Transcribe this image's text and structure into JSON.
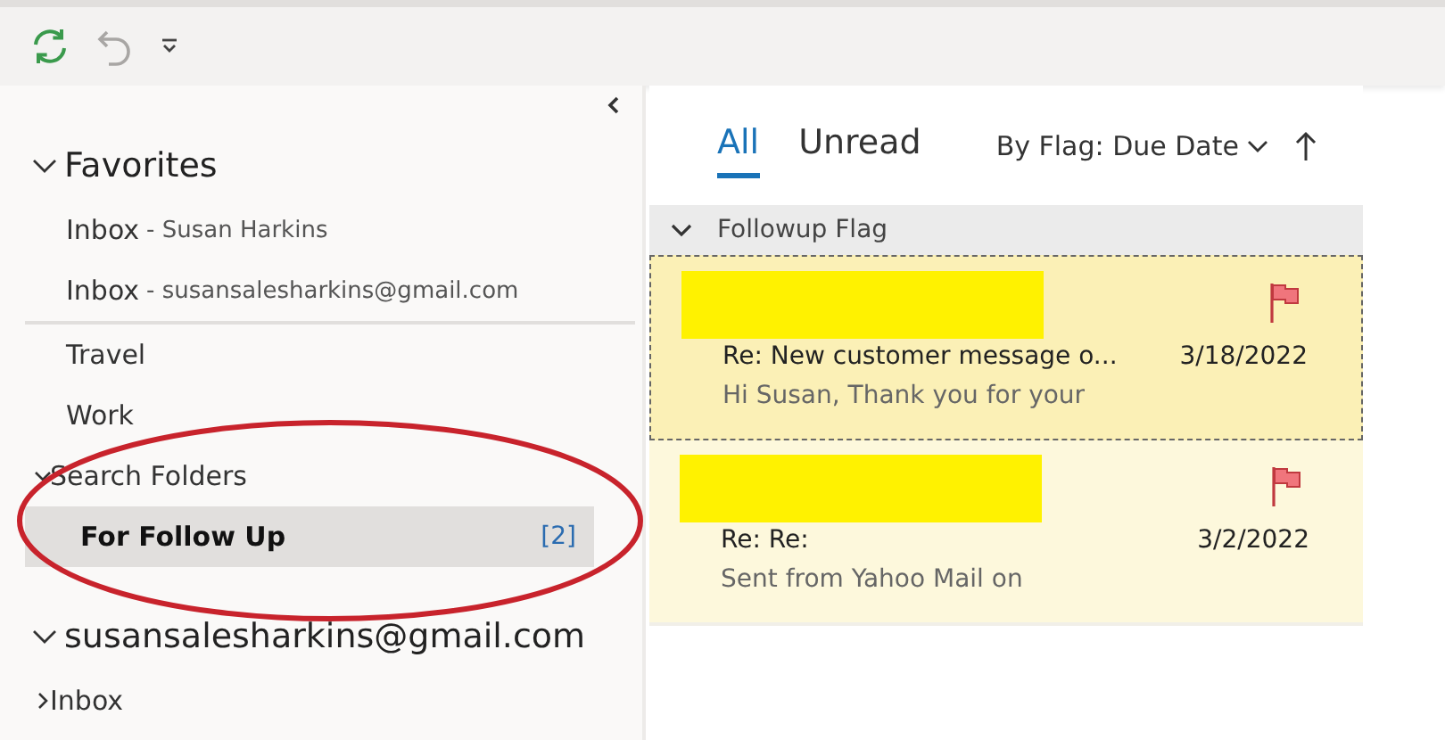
{
  "folder_pane": {
    "sections": [
      {
        "title": "Favorites",
        "expanded": true,
        "items": [
          {
            "label": "Inbox",
            "account": "- Susan Harkins",
            "selected": false
          },
          {
            "label": "Inbox",
            "account": "- susansalesharkins@gmail.com",
            "selected": false,
            "divider_after": true
          },
          {
            "label": "Travel",
            "selected": false
          },
          {
            "label": "Work",
            "selected": false
          },
          {
            "label": "Search Folders",
            "expanded": true,
            "children": [
              {
                "label": "For Follow Up",
                "count": "[2]",
                "selected": true
              }
            ]
          }
        ]
      },
      {
        "title": "susansalesharkins@gmail.com",
        "expanded": true,
        "items": [
          {
            "label": "Inbox",
            "expanded": false
          }
        ]
      }
    ]
  },
  "annotation": {
    "circled": true
  },
  "message_list": {
    "tabs": [
      {
        "label": "All",
        "selected": true
      },
      {
        "label": "Unread",
        "selected": false
      }
    ],
    "sort": "By Flag: Due Date",
    "group": {
      "title": "Followup Flag",
      "expanded": true
    },
    "messages": [
      {
        "sender_redacted": true,
        "subject": "Re: New customer message o...",
        "date": "3/18/2022",
        "preview": "Hi Susan,  Thank you for your",
        "flagged": true,
        "selected": true
      },
      {
        "sender_redacted": true,
        "subject": "Re: Re:",
        "date": "3/2/2022",
        "preview": "Sent from Yahoo Mail on",
        "flagged": true,
        "selected": false
      }
    ]
  }
}
